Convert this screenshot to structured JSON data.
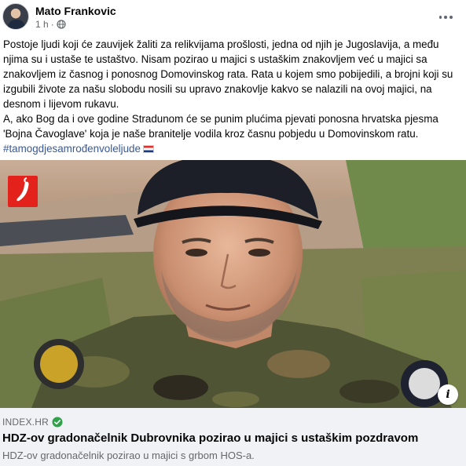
{
  "post": {
    "author": "Mato Frankovic",
    "time": "1 h",
    "meta_separator": "·",
    "text_lines": [
      "Postoje ljudi koji će zauvijek žaliti za relikvijama prošlosti, jedna od njih je Jugoslavija, a među",
      "njima su i ustaše te ustaštvo. Nisam pozirao u majici s ustaškim znakovljem već u majici sa",
      "znakovljem iz časnog i ponosnog Domovinskog rata. Rata u kojem smo pobijedili, a brojni koji su",
      "izgubili živote za našu slobodu nosili su upravo znakovlje kakvo se nalazili na ovoj majici, na",
      "desnom i lijevom rukavu.",
      "A, ako Bog da i ove godine Stradunom će se punim plućima pjevati ponosna hrvatska pjesma",
      "'Bojna Čavoglave' koja je naše branitelje vodila kroz časnu pobjedu u Domovinskom ratu."
    ],
    "hashtag": "#tamogdjesamrođenvoleljude"
  },
  "link_preview": {
    "domain": "INDEX.HR",
    "title": "HDZ-ov gradonačelnik Dubrovnika pozirao u majici s ustaškim pozdravom",
    "subtitle": "HDZ-ov gradonačelnik pozirao u majici s grbom HOS-a.",
    "info_glyph": "i"
  },
  "icons": {
    "more": "more-options-icon",
    "privacy": "globe-icon",
    "verified": "verified-check-icon",
    "flag": "croatia-flag-icon",
    "logo": "index-hr-chili-logo",
    "info": "info-icon"
  },
  "colors": {
    "link_blue": "#385898",
    "muted": "#65676b",
    "preview_bg": "#f0f2f5",
    "verified_green": "#31a24c",
    "logo_red": "#e3231b"
  }
}
